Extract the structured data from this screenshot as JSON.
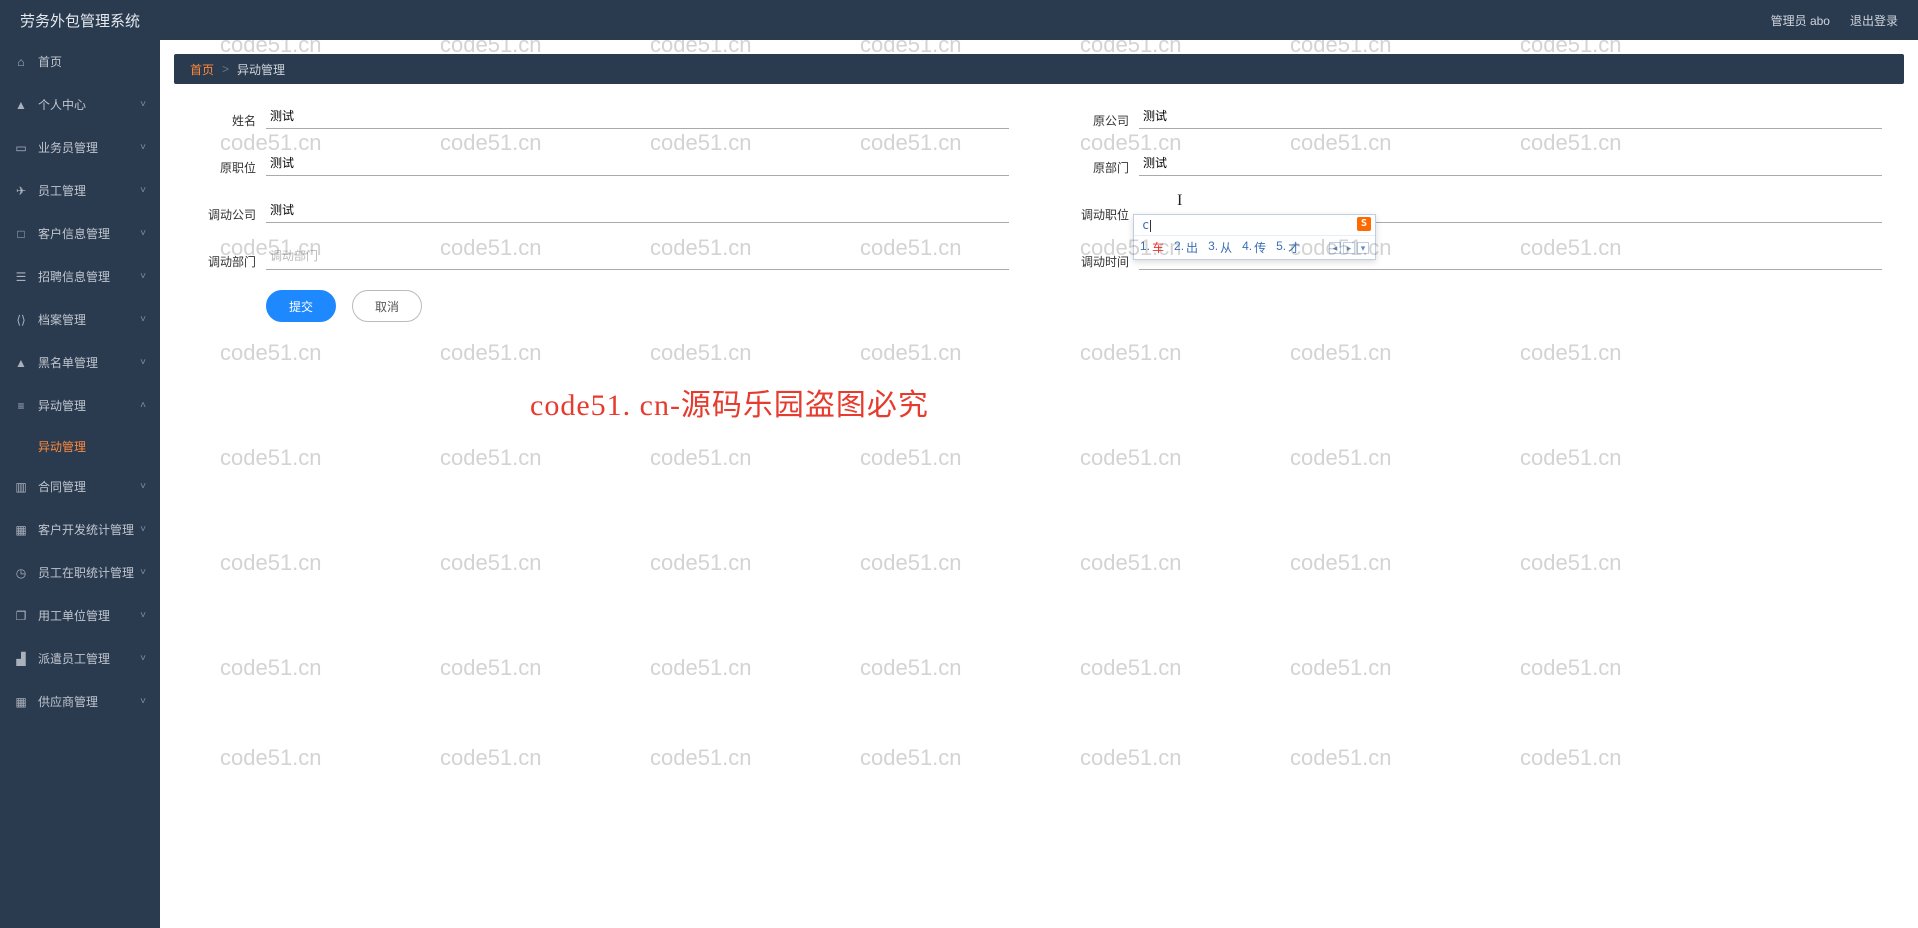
{
  "header": {
    "title": "劳务外包管理系统",
    "user_label": "管理员 abo",
    "logout_label": "退出登录"
  },
  "sidebar": {
    "items": [
      {
        "icon": "⌂",
        "label": "首页",
        "expand": false
      },
      {
        "icon": "▲",
        "label": "个人中心",
        "expand": true
      },
      {
        "icon": "▭",
        "label": "业务员管理",
        "expand": true
      },
      {
        "icon": "✈",
        "label": "员工管理",
        "expand": true
      },
      {
        "icon": "□",
        "label": "客户信息管理",
        "expand": true
      },
      {
        "icon": "☰",
        "label": "招聘信息管理",
        "expand": true
      },
      {
        "icon": "⟨⟩",
        "label": "档案管理",
        "expand": true
      },
      {
        "icon": "▲",
        "label": "黑名单管理",
        "expand": true
      },
      {
        "icon": "≡",
        "label": "异动管理",
        "expand": true,
        "open": true,
        "sub": [
          {
            "label": "异动管理"
          }
        ]
      },
      {
        "icon": "▥",
        "label": "合同管理",
        "expand": true
      },
      {
        "icon": "▦",
        "label": "客户开发统计管理",
        "expand": true
      },
      {
        "icon": "◷",
        "label": "员工在职统计管理",
        "expand": true
      },
      {
        "icon": "❐",
        "label": "用工单位管理",
        "expand": true
      },
      {
        "icon": "▟",
        "label": "派遣员工管理",
        "expand": true
      },
      {
        "icon": "▦",
        "label": "供应商管理",
        "expand": true
      }
    ]
  },
  "breadcrumb": {
    "home": "首页",
    "sep": ">",
    "current": "异动管理"
  },
  "form": {
    "name": {
      "label": "姓名",
      "value": "测试"
    },
    "orig_company": {
      "label": "原公司",
      "value": "测试"
    },
    "orig_job": {
      "label": "原职位",
      "value": "测试"
    },
    "orig_dept": {
      "label": "原部门",
      "value": "测试"
    },
    "move_company": {
      "label": "调动公司",
      "value": "测试"
    },
    "move_job": {
      "label": "调动职位",
      "value": ""
    },
    "move_dept": {
      "label": "调动部门",
      "value": "",
      "placeholder": "调动部门"
    },
    "move_time": {
      "label": "调动时间",
      "value": ""
    },
    "submit": "提交",
    "cancel": "取消"
  },
  "ime": {
    "input": "c",
    "logo": "S",
    "candidates": [
      {
        "n": "1.",
        "t": "车"
      },
      {
        "n": "2.",
        "t": "出"
      },
      {
        "n": "3.",
        "t": "从"
      },
      {
        "n": "4.",
        "t": "传"
      },
      {
        "n": "5.",
        "t": "才"
      }
    ],
    "prev": "◂",
    "next": "▸",
    "drop": "▾"
  },
  "watermark": {
    "text": "code51.cn",
    "big": "code51. cn-源码乐园盗图必究"
  }
}
